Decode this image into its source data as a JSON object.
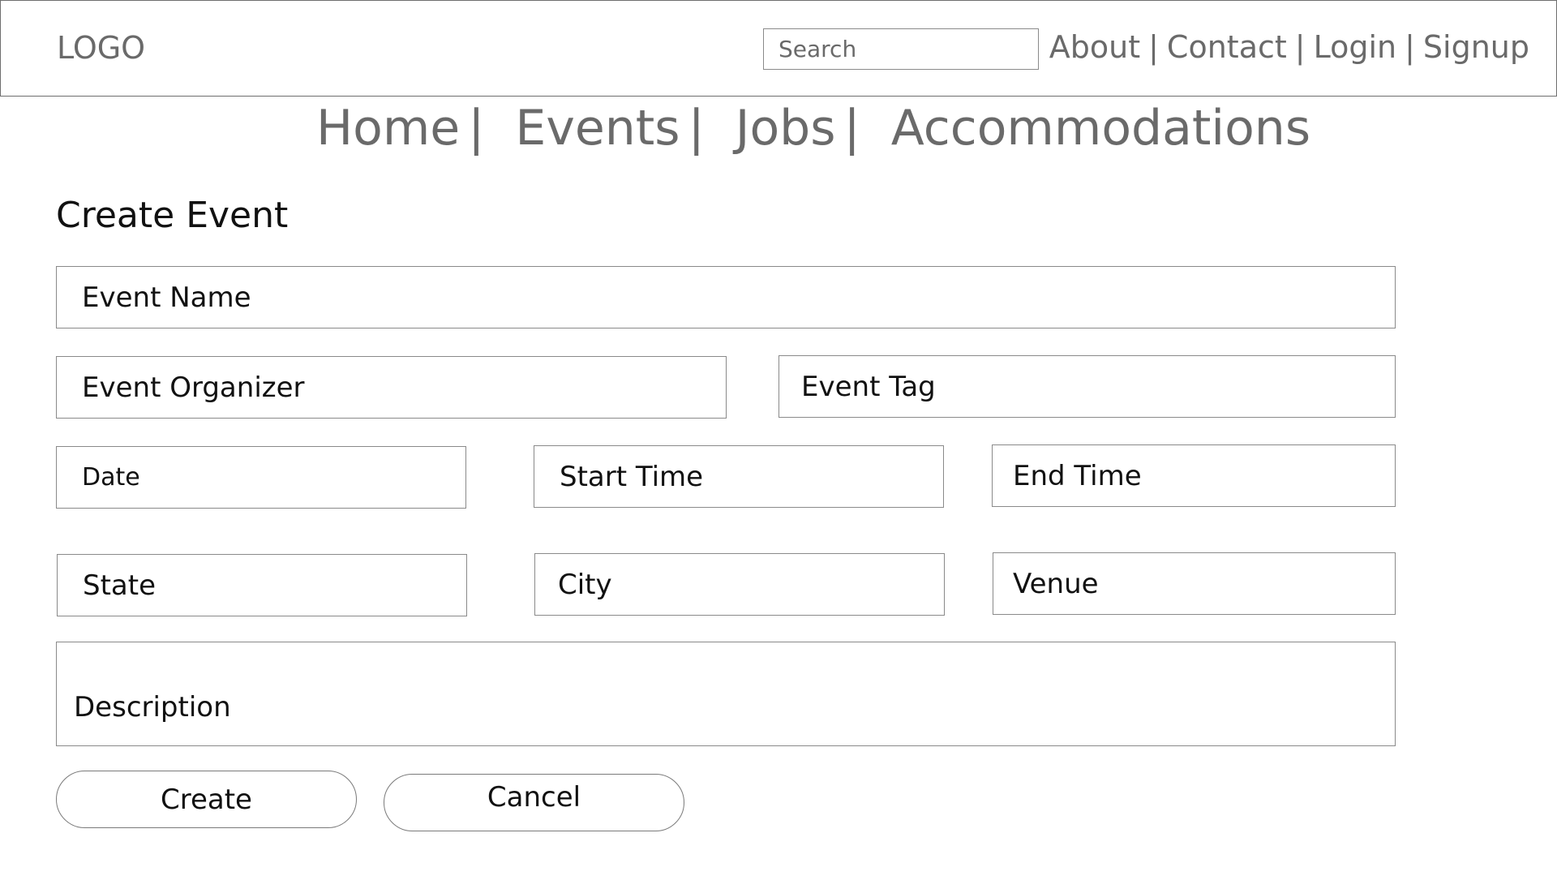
{
  "header": {
    "logo": "LOGO",
    "search_placeholder": "Search",
    "links": [
      "About",
      "Contact",
      "Login",
      "Signup"
    ],
    "separator": "|"
  },
  "nav": {
    "items": [
      "Home",
      "Events",
      "Jobs",
      "Accommodations"
    ],
    "separator": "|"
  },
  "form": {
    "title": "Create Event",
    "fields": {
      "event_name": "Event Name",
      "event_organizer": "Event Organizer",
      "event_tag": "Event Tag",
      "date": "Date",
      "start_time": "Start Time",
      "end_time": "End Time",
      "state": "State",
      "city": "City",
      "venue": "Venue",
      "description": "Description"
    },
    "buttons": {
      "create": "Create",
      "cancel": "Cancel"
    }
  }
}
